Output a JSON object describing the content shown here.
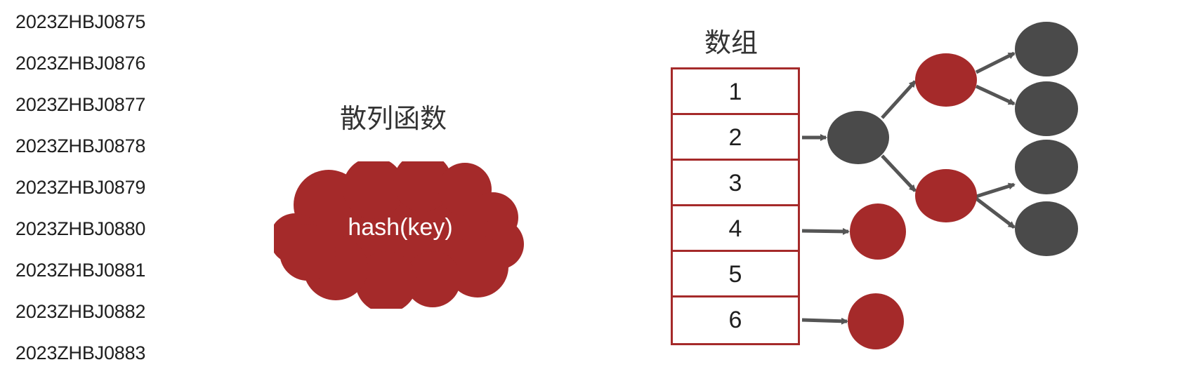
{
  "keys": [
    "2023ZHBJ0875",
    "2023ZHBJ0876",
    "2023ZHBJ0877",
    "2023ZHBJ0878",
    "2023ZHBJ0879",
    "2023ZHBJ0880",
    "2023ZHBJ0881",
    "2023ZHBJ0882",
    "2023ZHBJ0883"
  ],
  "hash_title": "散列函数",
  "hash_label": "hash(key)",
  "array_title": "数组",
  "array_slots": [
    "1",
    "2",
    "3",
    "4",
    "5",
    "6"
  ],
  "colors": {
    "red": "#a52a2a",
    "dark_gray": "#4a4a4a",
    "arrow": "#555555"
  },
  "icons": {
    "cloud": "hash-cloud-icon",
    "node": "circle-node"
  }
}
